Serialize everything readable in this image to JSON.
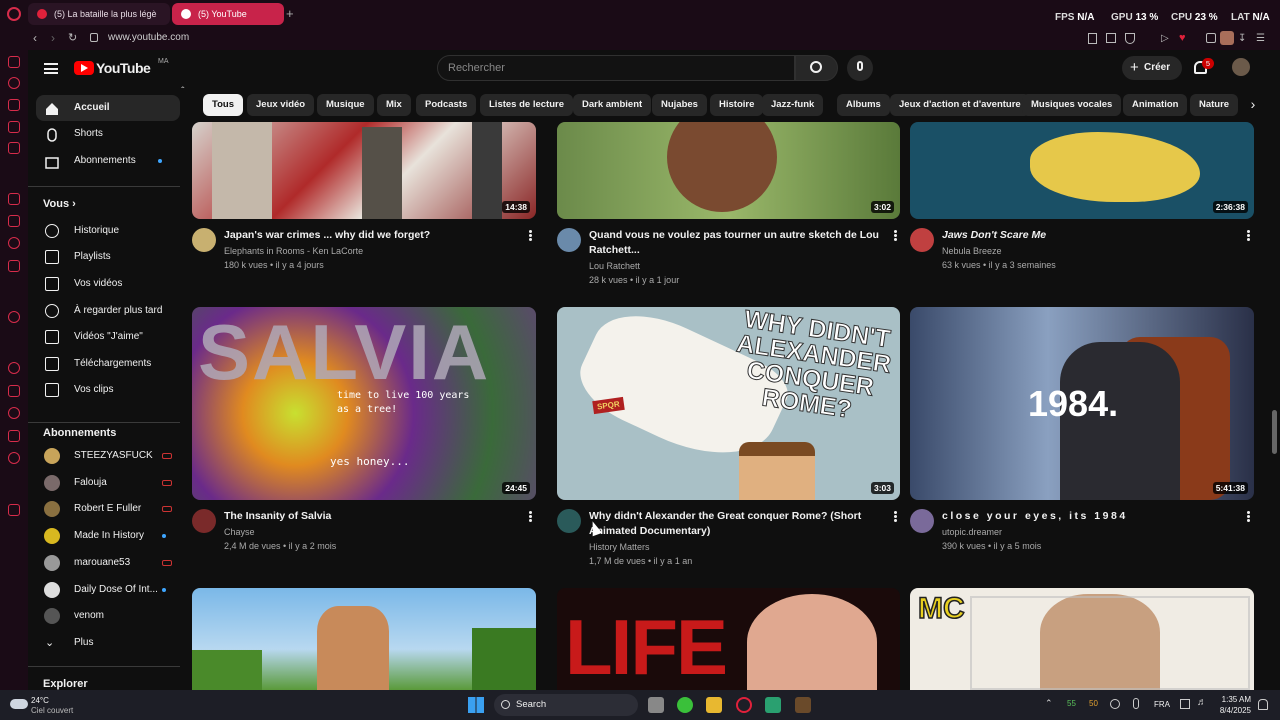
{
  "browser": {
    "tabs": [
      {
        "label": "(5) La bataille la plus légè"
      },
      {
        "label": "(5) YouTube"
      }
    ],
    "url": "www.youtube.com",
    "hud": {
      "fps_label": "FPS",
      "fps_value": "N/A",
      "gpu_label": "GPU",
      "gpu_value": "13 %",
      "cpu_label": "CPU",
      "cpu_value": "23 %",
      "lat_label": "LAT",
      "lat_value": "N/A"
    },
    "notification_count": "5"
  },
  "header": {
    "logo_text": "YouTube",
    "logo_region": "MA",
    "search_placeholder": "Rechercher",
    "create_label": "Créer",
    "notification_badge": "5"
  },
  "chips": [
    "Tous",
    "Jeux vidéo",
    "Musique",
    "Mix",
    "Podcasts",
    "Listes de lecture",
    "Dark ambient",
    "Nujabes",
    "Histoire",
    "Jazz-funk",
    "Albums",
    "Jeux d'action et d'aventure",
    "Musiques vocales",
    "Animation",
    "Nature"
  ],
  "sidebar": {
    "main": [
      {
        "label": "Accueil",
        "icon": "home-icon"
      },
      {
        "label": "Shorts",
        "icon": "shorts-icon"
      },
      {
        "label": "Abonnements",
        "icon": "subscriptions-icon"
      }
    ],
    "you_heading": "Vous",
    "you": [
      {
        "label": "Historique",
        "icon": "history-icon"
      },
      {
        "label": "Playlists",
        "icon": "playlists-icon"
      },
      {
        "label": "Vos vidéos",
        "icon": "your-videos-icon"
      },
      {
        "label": "À regarder plus tard",
        "icon": "watch-later-icon"
      },
      {
        "label": "Vidéos \"J'aime\"",
        "icon": "liked-icon"
      },
      {
        "label": "Téléchargements",
        "icon": "download-icon"
      },
      {
        "label": "Vos clips",
        "icon": "clips-icon"
      }
    ],
    "subs_heading": "Abonnements",
    "subs": [
      {
        "label": "STEEZYASFUCK",
        "color": "#c8a45a"
      },
      {
        "label": "Falouja",
        "color": "#7a6a6a"
      },
      {
        "label": "Robert E Fuller",
        "color": "#8a7040"
      },
      {
        "label": "Made In History",
        "color": "#d8b820"
      },
      {
        "label": "marouane53",
        "color": "#999999"
      },
      {
        "label": "Daily Dose Of Int...",
        "color": "#dddddd"
      },
      {
        "label": "venom",
        "color": "#555555"
      }
    ],
    "more_label": "Plus",
    "explore_heading": "Explorer"
  },
  "videos": [
    {
      "title": "Japan's war crimes ... why did we forget?",
      "channel": "Elephants in Rooms - Ken LaCorte",
      "meta": "180 k vues • il y a 4 jours",
      "duration": "14:38"
    },
    {
      "title": "Quand vous ne voulez pas tourner un autre sketch de Lou Ratchett...",
      "channel": "Lou Ratchett",
      "meta": "28 k vues • il y a 1 jour",
      "duration": "3:02"
    },
    {
      "title": "Jaws Don't Scare Me",
      "channel": "Nebula Breeze",
      "meta": "63 k vues • il y a 3 semaines",
      "duration": "2:36:38"
    },
    {
      "title": "The Insanity of Salvia",
      "channel": "Chayse",
      "meta": "2,4 M de vues • il y a 2 mois",
      "duration": "24:45",
      "thumb_text": [
        "SALVIA",
        "time to live 100 years as a tree!",
        "yes honey..."
      ]
    },
    {
      "title": "Why didn't Alexander the Great conquer Rome? (Short Animated Documentary)",
      "channel": "History Matters",
      "meta": "1,7 M de vues • il y a 1 an",
      "duration": "3:03",
      "thumb_text": [
        "WHY DIDN'T",
        "ALEXANDER",
        "CONQUER",
        "ROME?",
        "SPQR"
      ]
    },
    {
      "title": "close your eyes, its 1984",
      "channel": "utopic.dreamer",
      "meta": "390 k vues • il y a 5 mois",
      "duration": "5:41:38",
      "thumb_text": [
        "1984."
      ]
    },
    {
      "title": "",
      "thumb_text": [
        ""
      ]
    },
    {
      "title": "",
      "thumb_text": [
        "LIFE"
      ]
    },
    {
      "title": "",
      "thumb_text": [
        "MC"
      ]
    }
  ],
  "taskbar": {
    "weather_temp": "24°C",
    "weather_desc": "Ciel couvert",
    "search_label": "Search",
    "tray_a": "55",
    "tray_b": "50",
    "lang": "FRA",
    "time": "1:35 AM",
    "date": "8/4/2025"
  }
}
